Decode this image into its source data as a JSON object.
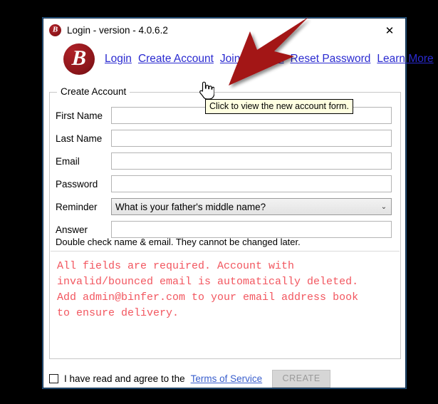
{
  "window": {
    "title": "Login - version - 4.0.6.2",
    "title_icon": "binfer-logo-icon",
    "close_icon": "✕"
  },
  "brand": {
    "logo_letter": "B",
    "logo_color": "#8e161b"
  },
  "nav": {
    "links": [
      {
        "label": "Login",
        "name": "nav-link-login"
      },
      {
        "label": "Create Account",
        "name": "nav-link-create-account"
      },
      {
        "label": "Join Network",
        "name": "nav-link-join-network"
      },
      {
        "label": "Reset Password",
        "name": "nav-link-reset-password"
      },
      {
        "label": "Learn More",
        "name": "nav-link-learn-more"
      }
    ],
    "link_color": "#2a2ad0"
  },
  "tooltip": {
    "text": "Click to view the new account form.",
    "background": "#ffffe1"
  },
  "form": {
    "legend": "Create Account",
    "fields": [
      {
        "label": "First Name",
        "value": "",
        "placeholder": ""
      },
      {
        "label": "Last Name",
        "value": "",
        "placeholder": ""
      },
      {
        "label": "Email",
        "value": "",
        "placeholder": ""
      },
      {
        "label": "Password",
        "value": "",
        "placeholder": ""
      }
    ],
    "reminder": {
      "label": "Reminder",
      "selected": "What is your father's middle name?",
      "arrow_icon": "⌄"
    },
    "answer": {
      "label": "Answer",
      "value": "",
      "placeholder": ""
    },
    "note": "Double check name & email. They cannot be changed later.",
    "warning": "All fields are required. Account with\ninvalid/bounced email is automatically deleted.\nAdd admin@binfer.com to your email address book\nto ensure delivery.",
    "warning_color": "#f2565f"
  },
  "footer": {
    "agree_text": "I have read and agree to the",
    "terms_label": "Terms of Service",
    "terms_color": "#3a5fcd",
    "create_label": "CREATE",
    "checkbox_checked": false
  },
  "annotation": {
    "arrow_color": "#a31216",
    "arrow_name": "red-pointer-arrow"
  }
}
